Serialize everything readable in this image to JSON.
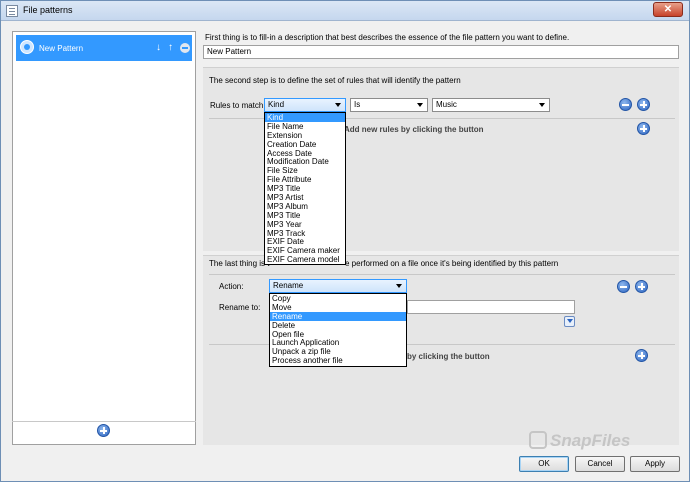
{
  "window": {
    "title": "File patterns",
    "close_glyph": "✕"
  },
  "patterns": [
    {
      "label": "New Pattern",
      "selected": true
    }
  ],
  "step1": {
    "instruction": "First thing is to fill-in a description that best describes the essence of the file pattern you want to define.",
    "description_value": "New Pattern"
  },
  "step2": {
    "instruction": "The second step is to define the set of rules that will identify the pattern",
    "rules_label": "Rules to match:",
    "rule": {
      "field": "Kind",
      "operator": "Is",
      "value": "Music"
    },
    "add_hint": "Add new rules by clicking the button",
    "field_options": [
      "Kind",
      "File Name",
      "Extension",
      "Creation Date",
      "Access Date",
      "Modification Date",
      "File Size",
      "File Attribute",
      "MP3 Title",
      "MP3 Artist",
      "MP3 Album",
      "MP3 Title",
      "MP3 Year",
      "MP3 Track",
      "EXIF Date",
      "EXIF Camera maker",
      "EXIF Camera model"
    ]
  },
  "step3": {
    "instruction_left": "The last thing is t",
    "instruction_right": "e performed on a file once it's being identified by this pattern",
    "action_label": "Action:",
    "action_value": "Rename",
    "rename_label": "Rename to:",
    "rename_value": "",
    "add_hint": "by clicking the button",
    "action_options": [
      "Copy",
      "Move",
      "Rename",
      "Delete",
      "Open file",
      "Launch Application",
      "Unpack a zip file",
      "Process another file"
    ]
  },
  "buttons": {
    "ok": "OK",
    "cancel": "Cancel",
    "apply": "Apply"
  },
  "watermark": "SnapFiles",
  "colors": {
    "selection": "#3399ff",
    "button_blue": "#2c64c0",
    "close_red": "#c7422a"
  }
}
